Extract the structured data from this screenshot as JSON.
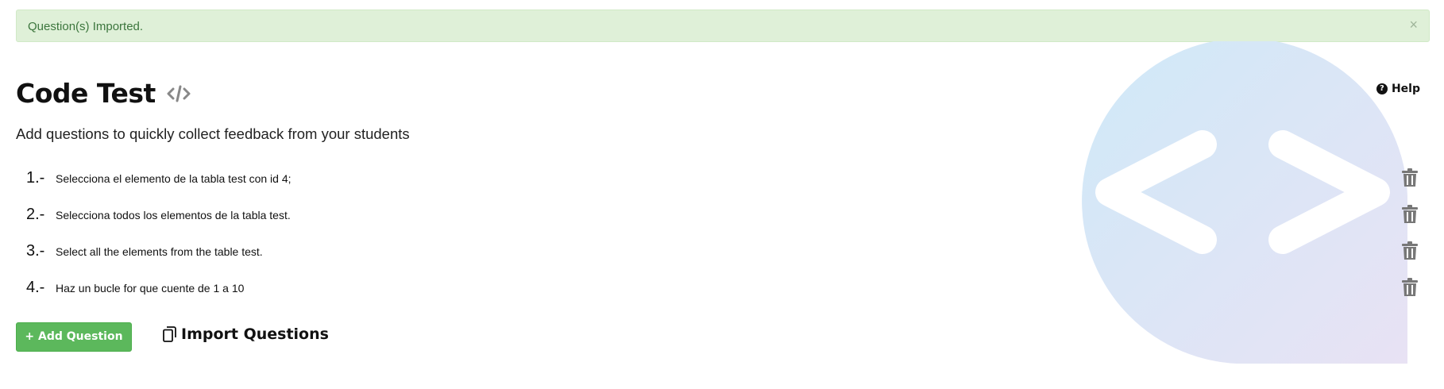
{
  "alert": {
    "message": "Question(s) Imported.",
    "close": "×"
  },
  "header": {
    "title": "Code Test",
    "subtitle": "Add questions to quickly collect feedback from your students",
    "help_label": "Help",
    "help_icon": "?"
  },
  "questions": [
    {
      "number": "1.-",
      "text": "Selecciona el elemento de la tabla test con id 4;"
    },
    {
      "number": "2.-",
      "text": "Selecciona todos los elementos de la tabla test."
    },
    {
      "number": "3.-",
      "text": "Select all the elements from the table test."
    },
    {
      "number": "4.-",
      "text": "Haz un bucle for que cuente de 1 a 10"
    }
  ],
  "actions": {
    "add_label": "+ Add Question",
    "import_label": "Import Questions"
  },
  "colors": {
    "alert_bg": "#dff0d8",
    "alert_text": "#3c763d",
    "add_button": "#5cb85c",
    "trash_icon": "#777777"
  },
  "icons": {
    "title_icon": "code-icon",
    "help_icon": "question-circle-icon",
    "trash_icon": "trash-icon",
    "import_icon": "copy-icon",
    "watermark": "code-brackets-icon"
  }
}
